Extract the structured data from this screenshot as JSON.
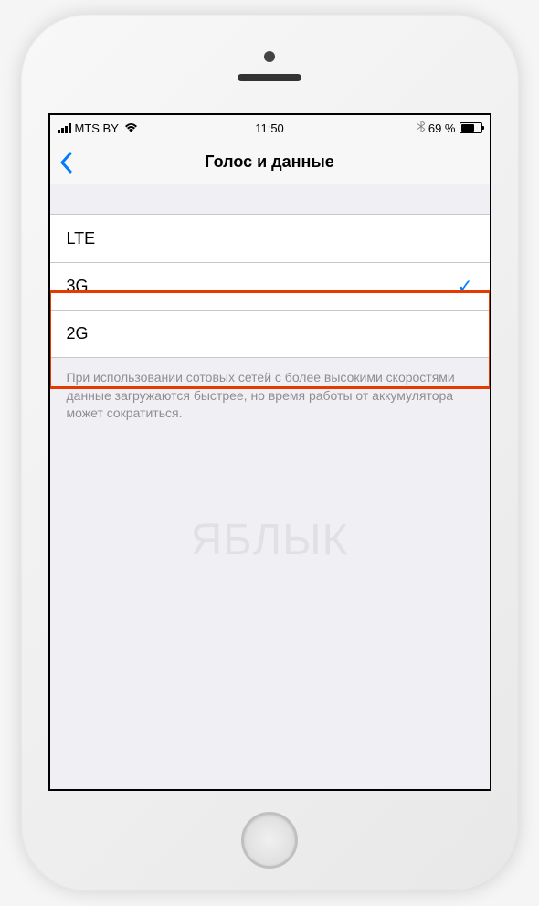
{
  "status_bar": {
    "carrier": "MTS BY",
    "time": "11:50",
    "battery_percent": "69 %",
    "bluetooth": "✻"
  },
  "nav": {
    "title": "Голос и данные"
  },
  "options": {
    "lte": "LTE",
    "g3": "3G",
    "g2": "2G",
    "selected": "3G"
  },
  "footer": "При использовании сотовых сетей с более высокими скоростями данные загружаются быстрее, но время работы от аккумулятора может сократиться.",
  "watermark": "ЯБЛЫК"
}
